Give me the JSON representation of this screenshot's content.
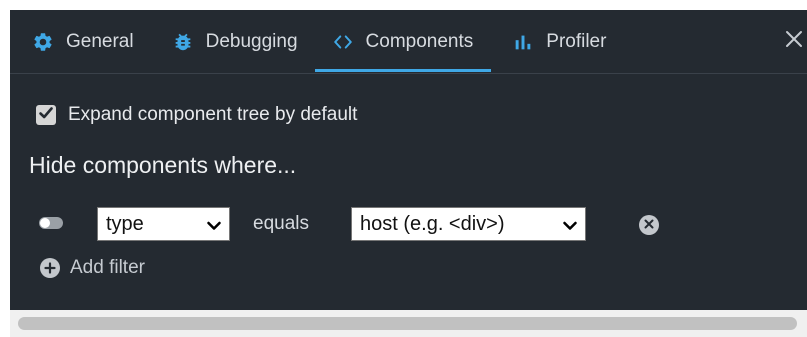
{
  "tabs": {
    "general": {
      "label": "General",
      "icon": "gear-icon",
      "icon_color": "#3fa8e6"
    },
    "debugging": {
      "label": "Debugging",
      "icon": "bug-icon",
      "icon_color": "#3fa8e6"
    },
    "components": {
      "label": "Components",
      "icon": "code-brackets-icon",
      "icon_color": "#3fa8e6",
      "active": true
    },
    "profiler": {
      "label": "Profiler",
      "icon": "bar-chart-icon",
      "icon_color": "#3fa8e6"
    },
    "close_icon": "close-icon"
  },
  "settings": {
    "expand_tree": {
      "label": "Expand component tree by default",
      "checked": true
    },
    "hide_heading": "Hide components where..."
  },
  "filter": {
    "enabled": false,
    "field": {
      "selected": "type"
    },
    "operator": "equals",
    "value": {
      "selected": "host (e.g. <div>)"
    },
    "remove_icon": "remove-circle-icon"
  },
  "add_filter": {
    "label": "Add filter",
    "icon": "plus-circle-icon"
  },
  "colors": {
    "panel_bg": "#242a31",
    "accent": "#3fa8e6",
    "text": "#e8eaed"
  }
}
